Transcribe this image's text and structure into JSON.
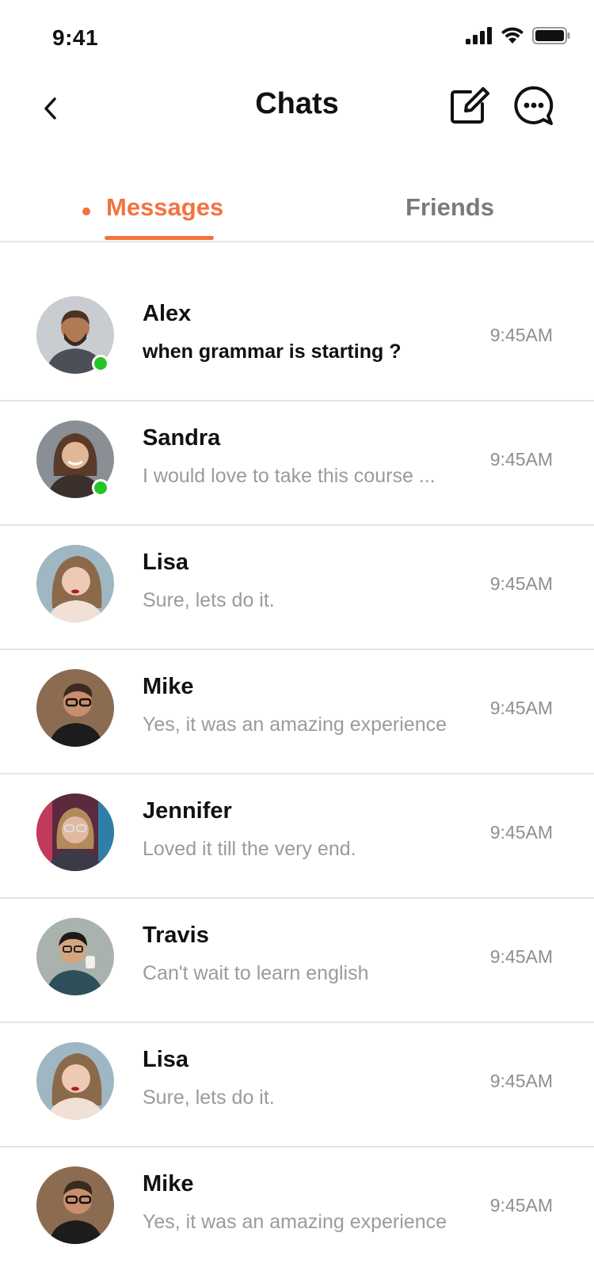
{
  "status_bar": {
    "time": "9:41",
    "icons": [
      "signal-icon",
      "wifi-icon",
      "battery-icon"
    ]
  },
  "nav": {
    "title": "Chats",
    "icons": [
      "back-arrow-icon",
      "compose-icon",
      "chat-bubble-icon"
    ]
  },
  "tabs": [
    {
      "label": "Messages",
      "active": true
    },
    {
      "label": "Friends",
      "active": false
    }
  ],
  "colors": {
    "accent": "#f2733e",
    "online": "#27c427",
    "muted_text": "#9b9b9b",
    "divider": "#e3e3e3"
  },
  "chats": [
    {
      "name": "Alex",
      "preview": "when grammar is starting ?",
      "time": "9:45AM",
      "online": true,
      "unread": true
    },
    {
      "name": "Sandra",
      "preview": "I would love to take this course ...",
      "time": "9:45AM",
      "online": true,
      "unread": false
    },
    {
      "name": "Lisa",
      "preview": "Sure, lets do it.",
      "time": "9:45AM",
      "online": false,
      "unread": false
    },
    {
      "name": "Mike",
      "preview": "Yes, it was an amazing experience",
      "time": "9:45AM",
      "online": false,
      "unread": false
    },
    {
      "name": "Jennifer",
      "preview": "Loved it till the very end.",
      "time": "9:45AM",
      "online": false,
      "unread": false
    },
    {
      "name": "Travis",
      "preview": "Can't wait to learn english",
      "time": "9:45AM",
      "online": false,
      "unread": false
    },
    {
      "name": "Lisa",
      "preview": "Sure, lets do it.",
      "time": "9:45AM",
      "online": false,
      "unread": false
    },
    {
      "name": "Mike",
      "preview": "Yes, it was an amazing experience",
      "time": "9:45AM",
      "online": false,
      "unread": false
    }
  ]
}
